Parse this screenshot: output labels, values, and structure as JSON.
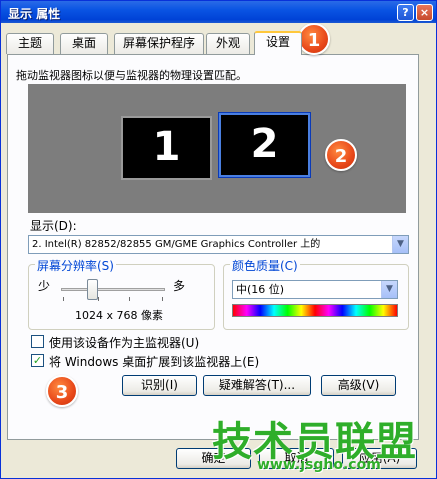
{
  "window": {
    "title": "显示 属性",
    "help_label": "?",
    "close_label": "×"
  },
  "tabs": [
    {
      "label": "主题"
    },
    {
      "label": "桌面"
    },
    {
      "label": "屏幕保护程序"
    },
    {
      "label": "外观"
    },
    {
      "label": "设置",
      "active": true
    }
  ],
  "settings": {
    "instruction": "拖动监视器图标以便与监视器的物理设置匹配。",
    "monitors": [
      {
        "label": "1",
        "selected": false
      },
      {
        "label": "2",
        "selected": true
      }
    ],
    "display_label": "显示(D):",
    "display_value": "2. Intel(R) 82852/82855 GM/GME Graphics Controller 上的",
    "resolution": {
      "title": "屏幕分辨率(S)",
      "less": "少",
      "more": "多",
      "value": "1024 x 768 像素",
      "slider_position": 0.3
    },
    "color_quality": {
      "title": "颜色质量(C)",
      "value": "中(16 位)"
    },
    "checkboxes": [
      {
        "label": "使用该设备作为主监视器(U)",
        "checked": false
      },
      {
        "label": "将 Windows 桌面扩展到该监视器上(E)",
        "checked": true
      }
    ],
    "buttons": {
      "identify": "识别(I)",
      "troubleshoot": "疑难解答(T)...",
      "advanced": "高级(V)"
    }
  },
  "footer": {
    "ok": "确定",
    "cancel": "取消",
    "apply": "应用(A)"
  },
  "annotations": [
    "1",
    "2",
    "3"
  ],
  "watermark": {
    "brand": "技术员联盟",
    "url": "www.jsgho.com"
  },
  "colors": {
    "title_bar": "#0a54e3",
    "window_bg": "#ece9d8",
    "monitor_area": "#7d7d7d",
    "badge": "#e8481a",
    "group_title": "#0046d5",
    "watermark": "#2fae2a"
  }
}
